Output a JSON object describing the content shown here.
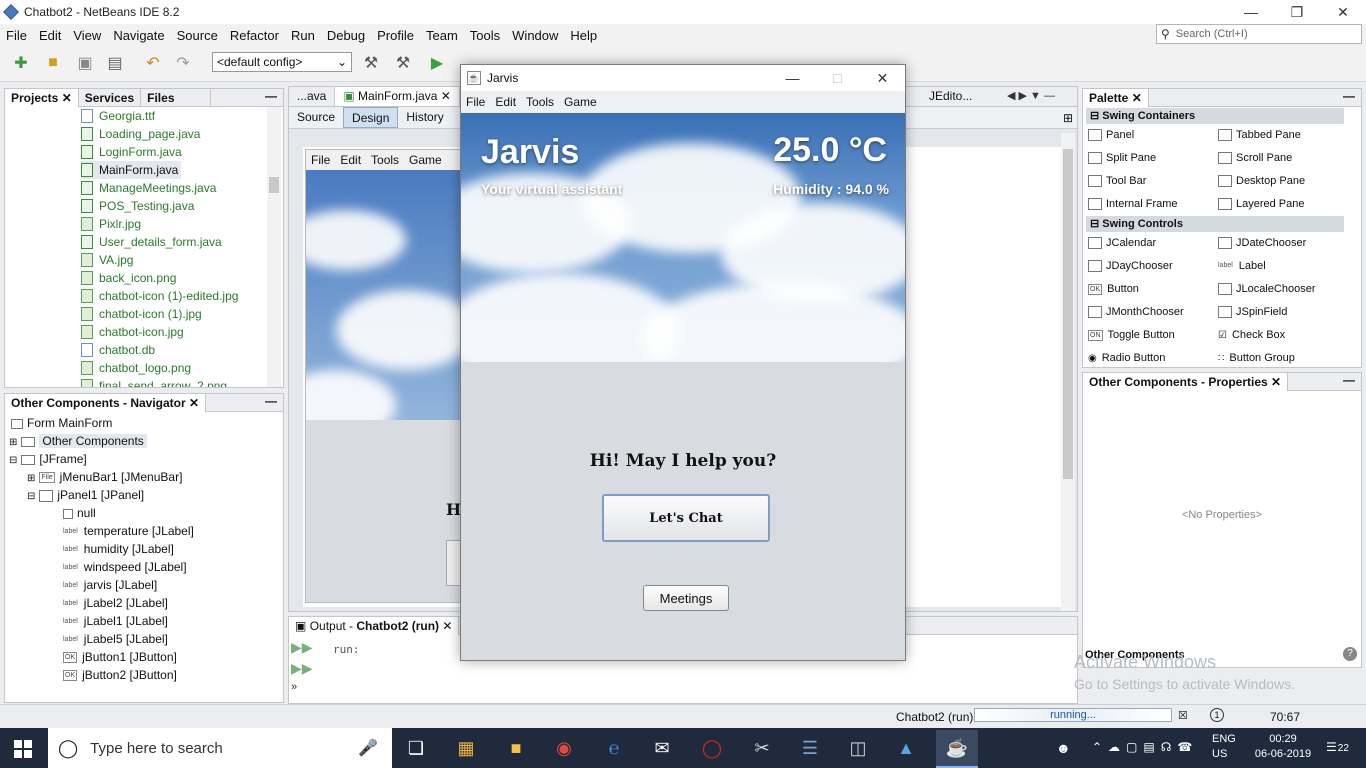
{
  "ide": {
    "title": "Chatbot2 - NetBeans IDE 8.2",
    "menu": [
      "File",
      "Edit",
      "View",
      "Navigate",
      "Source",
      "Refactor",
      "Run",
      "Debug",
      "Profile",
      "Team",
      "Tools",
      "Window",
      "Help"
    ],
    "search_placeholder": "Search (Ctrl+I)",
    "config": "<default config>"
  },
  "projects_panel": {
    "tabs": [
      "Projects",
      "Services",
      "Files"
    ],
    "files": [
      "Georgia.ttf",
      "Loading_page.java",
      "LoginForm.java",
      "MainForm.java",
      "ManageMeetings.java",
      "POS_Testing.java",
      "Pixlr.jpg",
      "User_details_form.java",
      "VA.jpg",
      "back_icon.png",
      "chatbot-icon (1)-edited.jpg",
      "chatbot-icon (1).jpg",
      "chatbot-icon.jpg",
      "chatbot.db",
      "chatbot_logo.png",
      "final_send_arrow_2.png"
    ]
  },
  "navigator": {
    "title": "Other Components - Navigator",
    "form": "Form MainForm",
    "other": "Other Components",
    "frame": "[JFrame]",
    "menubar": "jMenuBar1 [JMenuBar]",
    "panel": "jPanel1 [JPanel]",
    "children": [
      "null",
      "temperature [JLabel]",
      "humidity [JLabel]",
      "windspeed [JLabel]",
      "jarvis [JLabel]",
      "jLabel2 [JLabel]",
      "jLabel1 [JLabel]",
      "jLabel5 [JLabel]",
      "jButton1 [JButton]",
      "jButton2 [JButton]"
    ]
  },
  "editor": {
    "tabs": [
      "...ava",
      "MainForm.java",
      "JEdito..."
    ],
    "subtabs": [
      "Source",
      "Design",
      "History"
    ],
    "design_menu": [
      "File",
      "Edit",
      "Tools",
      "Game"
    ],
    "hidden_text": "H"
  },
  "output": {
    "title_prefix": "Output - ",
    "title_project": "Chatbot2 (run)",
    "line": "run:"
  },
  "palette": {
    "title": "Palette",
    "containers_header": "Swing Containers",
    "containers": [
      "Panel",
      "Tabbed Pane",
      "Split Pane",
      "Scroll Pane",
      "Tool Bar",
      "Desktop Pane",
      "Internal Frame",
      "Layered Pane"
    ],
    "controls_header": "Swing Controls",
    "controls": [
      "JCalendar",
      "JDateChooser",
      "JDayChooser",
      "Label",
      "Button",
      "JLocaleChooser",
      "JMonthChooser",
      "JSpinField",
      "Toggle Button",
      "Check Box",
      "Radio Button",
      "Button Group"
    ]
  },
  "properties": {
    "title": "Other Components - Properties",
    "empty": "<No Properties>",
    "footer": "Other Components"
  },
  "activate": {
    "line1": "Activate Windows",
    "line2": "Go to Settings to activate Windows."
  },
  "status": {
    "project": "Chatbot2 (run)",
    "progress_text": "running...",
    "position": "70:67"
  },
  "jarvis": {
    "title": "Jarvis",
    "menu": [
      "File",
      "Edit",
      "Tools",
      "Game"
    ],
    "name": "Jarvis",
    "subtitle": "Your virtual assistant",
    "temperature": "25.0 °C",
    "humidity": "Humidity : 94.0 %",
    "greeting": "Hi! May I help you?",
    "chat_button": "Let's Chat",
    "meetings_button": "Meetings"
  },
  "taskbar": {
    "search_placeholder": "Type here to search",
    "lang1": "ENG",
    "lang2": "US",
    "time": "00:29",
    "date": "06-06-2019",
    "notifications": "22"
  }
}
